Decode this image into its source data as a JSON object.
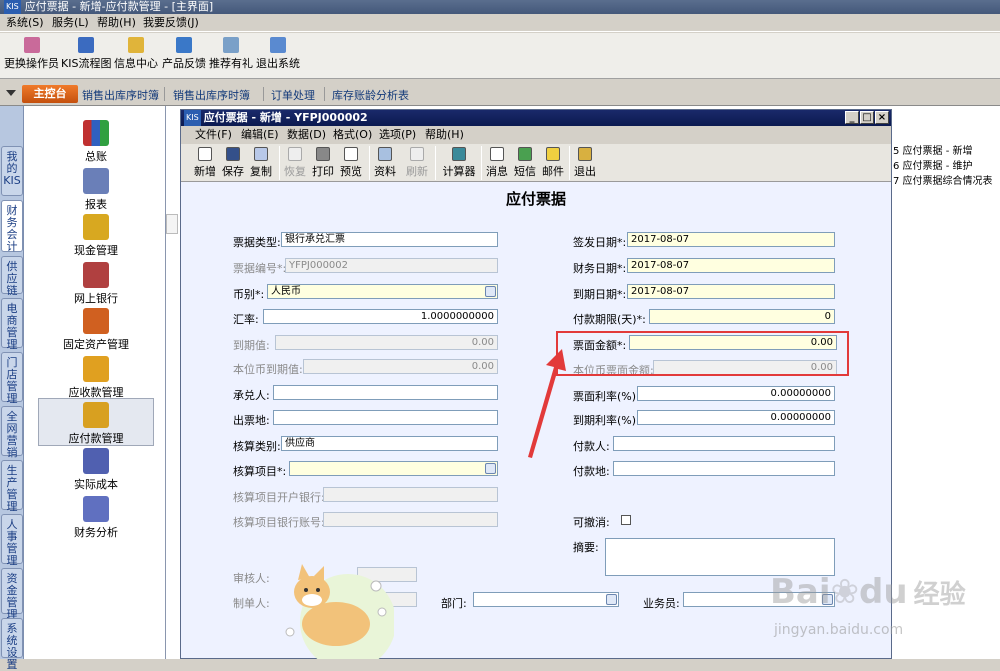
{
  "outer_window": {
    "logo": "KIS",
    "title": "应付票据 - 新增-应付款管理 - [主界面]"
  },
  "outer_menu": [
    "系统(S)",
    "服务(L)",
    "帮助(H)",
    "我要反馈(J)"
  ],
  "outer_toolbar": [
    {
      "label": "更换操作员",
      "icon": "user-switch-icon"
    },
    {
      "label": "KIS流程图",
      "icon": "flowchart-icon"
    },
    {
      "label": "信息中心",
      "icon": "message-center-icon"
    },
    {
      "label": "产品反馈",
      "icon": "feedback-icon"
    },
    {
      "label": "推荐有礼",
      "icon": "gift-icon"
    },
    {
      "label": "退出系统",
      "icon": "exit-system-icon"
    }
  ],
  "tabs": {
    "main": "主控台",
    "items": [
      "销售出库序时簿",
      "销售出库序时簿",
      "订单处理",
      "库存账龄分析表"
    ]
  },
  "vtabs": [
    "我的KIS",
    "财务会计",
    "供应链",
    "电商管理",
    "门店管理",
    "全网营销",
    "生产管理",
    "人事管理",
    "资金管理",
    "系统设置"
  ],
  "nav_items": [
    {
      "label": "总账",
      "icon": "ledger-books-icon"
    },
    {
      "label": "报表",
      "icon": "report-icon"
    },
    {
      "label": "现金管理",
      "icon": "cash-management-icon"
    },
    {
      "label": "网上银行",
      "icon": "online-bank-icon"
    },
    {
      "label": "固定资产管理",
      "icon": "fixed-assets-icon"
    },
    {
      "label": "应收款管理",
      "icon": "receivables-icon"
    },
    {
      "label": "应付款管理",
      "icon": "payables-icon"
    },
    {
      "label": "实际成本",
      "icon": "actual-cost-icon"
    },
    {
      "label": "财务分析",
      "icon": "financial-analysis-icon"
    }
  ],
  "right_list": [
    "5  应付票据 - 新增",
    "6  应付票据 - 维护",
    "7  应付票据综合情况表"
  ],
  "inner_window": {
    "logo": "KIS",
    "title": "应付票据 - 新增 - YFPJ000002",
    "menu": [
      "文件(F)",
      "编辑(E)",
      "数据(D)",
      "格式(O)",
      "选项(P)",
      "帮助(H)"
    ],
    "toolbar": [
      {
        "label": "新增",
        "icon": "new-doc-icon",
        "disabled": false
      },
      {
        "label": "保存",
        "icon": "save-icon",
        "disabled": false
      },
      {
        "label": "复制",
        "icon": "copy-icon",
        "disabled": false
      },
      {
        "label": "恢复",
        "icon": "restore-icon",
        "disabled": true
      },
      {
        "label": "打印",
        "icon": "print-icon",
        "disabled": false
      },
      {
        "label": "预览",
        "icon": "preview-icon",
        "disabled": false
      },
      {
        "label": "资料",
        "icon": "data-icon",
        "disabled": false
      },
      {
        "label": "刷新",
        "icon": "refresh-icon",
        "disabled": true
      },
      {
        "label": "计算器",
        "icon": "calculator-icon",
        "disabled": false
      },
      {
        "label": "消息",
        "icon": "message-icon",
        "disabled": false
      },
      {
        "label": "短信",
        "icon": "sms-icon",
        "disabled": false
      },
      {
        "label": "邮件",
        "icon": "mail-icon",
        "disabled": false
      },
      {
        "label": "退出",
        "icon": "exit-icon",
        "disabled": false
      }
    ]
  },
  "form": {
    "title": "应付票据",
    "left": {
      "bill_type": {
        "label": "票据类型:",
        "value": "银行承兑汇票"
      },
      "bill_no": {
        "label": "票据编号*:",
        "value": "YFPJ000002"
      },
      "currency": {
        "label": "币别*:",
        "value": "人民币"
      },
      "rate": {
        "label": "汇率:",
        "value": "1.0000000000"
      },
      "maturity_value": {
        "label": "到期值:",
        "value": "0.00"
      },
      "local_maturity_value": {
        "label": "本位币到期值:",
        "value": "0.00"
      },
      "acceptor": {
        "label": "承兑人:",
        "value": ""
      },
      "issue_place": {
        "label": "出票地:",
        "value": ""
      },
      "acct_category": {
        "label": "核算类别:",
        "value": "供应商"
      },
      "acct_item": {
        "label": "核算项目*:",
        "value": ""
      },
      "acct_bank": {
        "label": "核算项目开户银行:",
        "value": ""
      },
      "acct_bank_no": {
        "label": "核算项目银行账号:",
        "value": ""
      },
      "reviewer": {
        "label": "审核人:",
        "value": ""
      },
      "maker": {
        "label": "制单人:",
        "value": ""
      },
      "department": {
        "label": "部门:",
        "value": ""
      },
      "salesman": {
        "label": "业务员:",
        "value": ""
      }
    },
    "right": {
      "issue_date": {
        "label": "签发日期*:",
        "value": "2017-08-07"
      },
      "finance_date": {
        "label": "财务日期*:",
        "value": "2017-08-07"
      },
      "due_date": {
        "label": "到期日期*:",
        "value": "2017-08-07"
      },
      "pay_term": {
        "label": "付款期限(天)*:",
        "value": "0"
      },
      "face_amount": {
        "label": "票面金额*:",
        "value": "0.00"
      },
      "local_face_amount": {
        "label": "本位币票面金额:",
        "value": "0.00"
      },
      "face_rate": {
        "label": "票面利率(%):",
        "value": "0.00000000"
      },
      "due_rate": {
        "label": "到期利率(%):",
        "value": "0.00000000"
      },
      "payer": {
        "label": "付款人:",
        "value": ""
      },
      "pay_place": {
        "label": "付款地:",
        "value": ""
      },
      "cancelable": {
        "label": "可撤消:"
      },
      "summary": {
        "label": "摘要:",
        "value": ""
      }
    }
  },
  "watermark": {
    "brand": "Bai",
    "brand2": "du",
    "cn": "经验",
    "url": "jingyan.baidu.com"
  },
  "colors": {
    "highlight": "#e23a3a",
    "title_bar": "#0b1a50",
    "required_field": "#ffffe0"
  }
}
